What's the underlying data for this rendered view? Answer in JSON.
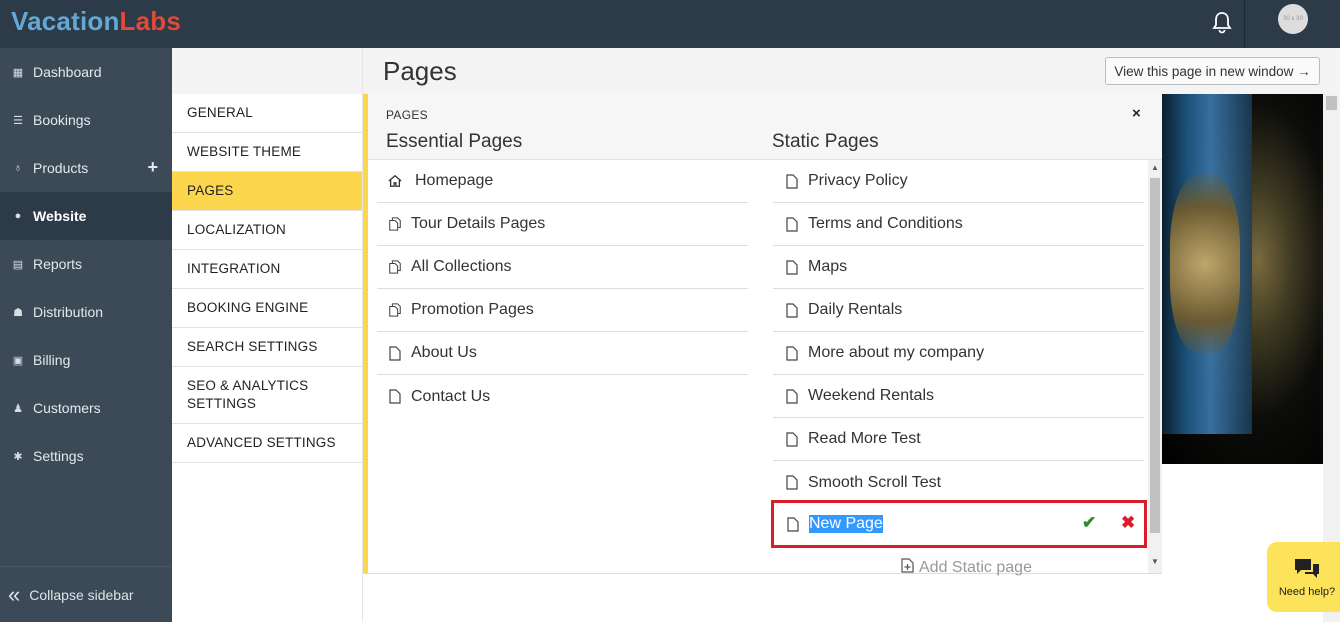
{
  "topbar": {
    "logo_part1": "Vacation",
    "logo_part2": "Labs",
    "avatar_text": "30 x 30",
    "icons": [
      "bell-icon"
    ]
  },
  "sidebar": {
    "items": [
      {
        "label": "Dashboard",
        "icon": "calendar-icon"
      },
      {
        "label": "Bookings",
        "icon": "list-icon"
      },
      {
        "label": "Products",
        "icon": "lightbulb-icon",
        "action": "+"
      },
      {
        "label": "Website",
        "icon": "globe-icon",
        "active": true
      },
      {
        "label": "Reports",
        "icon": "report-icon"
      },
      {
        "label": "Distribution",
        "icon": "users-icon"
      },
      {
        "label": "Billing",
        "icon": "money-icon"
      },
      {
        "label": "Customers",
        "icon": "user-icon"
      },
      {
        "label": "Settings",
        "icon": "gear-icon"
      }
    ],
    "collapse_label": "Collapse sidebar"
  },
  "submenu": {
    "items": [
      {
        "label": "GENERAL"
      },
      {
        "label": "WEBSITE THEME"
      },
      {
        "label": "PAGES",
        "active": true
      },
      {
        "label": "LOCALIZATION"
      },
      {
        "label": "INTEGRATION"
      },
      {
        "label": "BOOKING ENGINE"
      },
      {
        "label": "SEARCH SETTINGS"
      },
      {
        "label": "SEO & ANALYTICS SETTINGS"
      },
      {
        "label": "ADVANCED SETTINGS"
      }
    ]
  },
  "header": {
    "title": "Pages",
    "view_button": "View this page in new window →"
  },
  "panel": {
    "label": "PAGES",
    "close": "×",
    "essential_title": "Essential Pages",
    "static_title": "Static Pages",
    "essential_pages": [
      {
        "label": "Homepage",
        "icon": "home-icon"
      },
      {
        "label": "Tour Details Pages",
        "icon": "files-icon"
      },
      {
        "label": "All Collections",
        "icon": "files-icon"
      },
      {
        "label": "Promotion Pages",
        "icon": "files-icon"
      },
      {
        "label": "About Us",
        "icon": "file-icon"
      },
      {
        "label": "Contact Us",
        "icon": "file-icon"
      }
    ],
    "static_pages": [
      {
        "label": "Privacy Policy"
      },
      {
        "label": "Terms and Conditions"
      },
      {
        "label": "Maps"
      },
      {
        "label": "Daily Rentals"
      },
      {
        "label": "More about my company"
      },
      {
        "label": "Weekend Rentals"
      },
      {
        "label": "Read More Test"
      },
      {
        "label": "Smooth Scroll Test"
      }
    ],
    "new_page_value": "New Page",
    "add_static_label": "Add Static page"
  },
  "help": {
    "label": "Need help?"
  }
}
